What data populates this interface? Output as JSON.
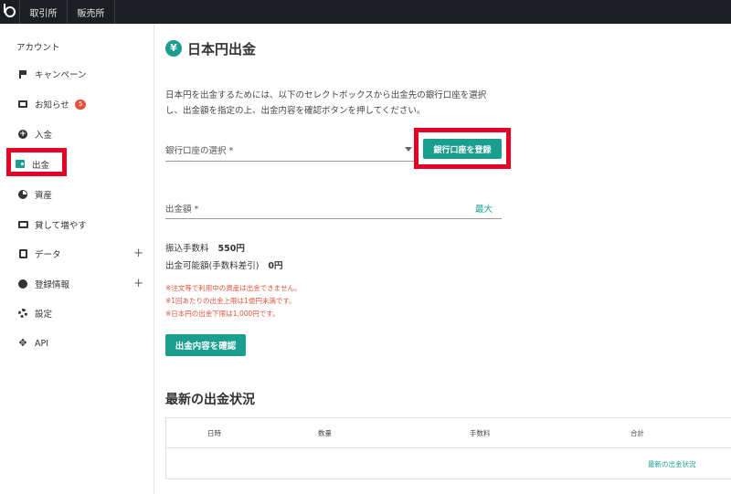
{
  "topbar": {
    "tabs": [
      "取引所",
      "販売所"
    ]
  },
  "sidebar": {
    "title": "アカウント",
    "items": [
      {
        "label": "キャンペーン"
      },
      {
        "label": "お知らせ",
        "badge": "5"
      },
      {
        "label": "入金"
      },
      {
        "label": "出金"
      },
      {
        "label": "資産"
      },
      {
        "label": "貸して増やす"
      },
      {
        "label": "データ",
        "expand": "+"
      },
      {
        "label": "登録情報",
        "expand": "+"
      },
      {
        "label": "設定"
      },
      {
        "label": "API"
      }
    ]
  },
  "main": {
    "title_icon": "¥",
    "title": "日本円出金",
    "description_line1": "日本円を出金するためには、以下のセレクトボックスから出金先の銀行口座を選択",
    "description_line2": "し、出金額を指定の上、出金内容を確認ボタンを押してください。",
    "bank_select_label": "銀行口座の選択 *",
    "register_button": "銀行口座を登録",
    "amount_label": "出金額 *",
    "max_label": "最大",
    "fee_label": "振込手数料",
    "fee_value": "550円",
    "available_label": "出金可能額(手数料差引)",
    "available_value": "0円",
    "notes": [
      "※注文等で利用中の資産は出金できません。",
      "※1回あたりの出金上限は1億円未満です。",
      "※日本円の出金下限は1,000円です。"
    ],
    "confirm_button": "出金内容を確認",
    "history_title": "最新の出金状況",
    "table_headers": [
      "日時",
      "数量",
      "手数料",
      "合計"
    ],
    "history_link": "最新の出金状況"
  },
  "colors": {
    "accent": "#1a9e8f",
    "highlight": "#e60026",
    "topbar": "#1b1f23",
    "badge": "#e5533d"
  }
}
